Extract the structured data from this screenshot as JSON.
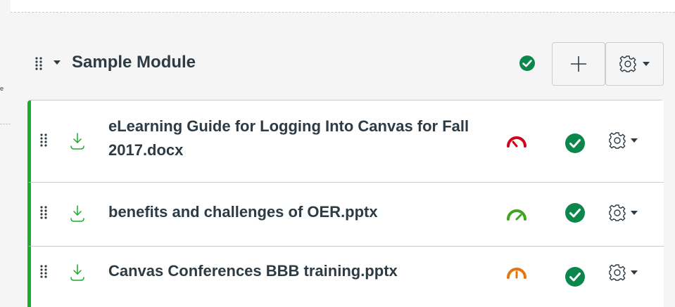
{
  "sidebar_fragment": {
    "text": "e"
  },
  "module": {
    "title": "Sample Module",
    "published": true,
    "add_label": "+",
    "colors": {
      "published_green": "#0b874b",
      "item_border_green": "#1aab2f",
      "download_green": "#1aab2f"
    },
    "icons": {
      "drag": "drag-handle-icon",
      "collapse": "caret-down-icon",
      "add": "plus-icon",
      "settings": "gear-icon",
      "published": "check-circle-icon",
      "download": "download-icon",
      "difficulty": "speedometer-icon"
    }
  },
  "items": [
    {
      "title": "eLearning Guide for Logging Into Canvas for Fall 2017.docx",
      "gauge_color": "#d0021b",
      "gauge_level": "low",
      "published": true
    },
    {
      "title": "benefits and challenges of OER.pptx",
      "gauge_color": "#3ea51f",
      "gauge_level": "high",
      "published": true
    },
    {
      "title": "Canvas Conferences BBB training.pptx",
      "gauge_color": "#e8740c",
      "gauge_level": "medium",
      "published": true
    }
  ]
}
